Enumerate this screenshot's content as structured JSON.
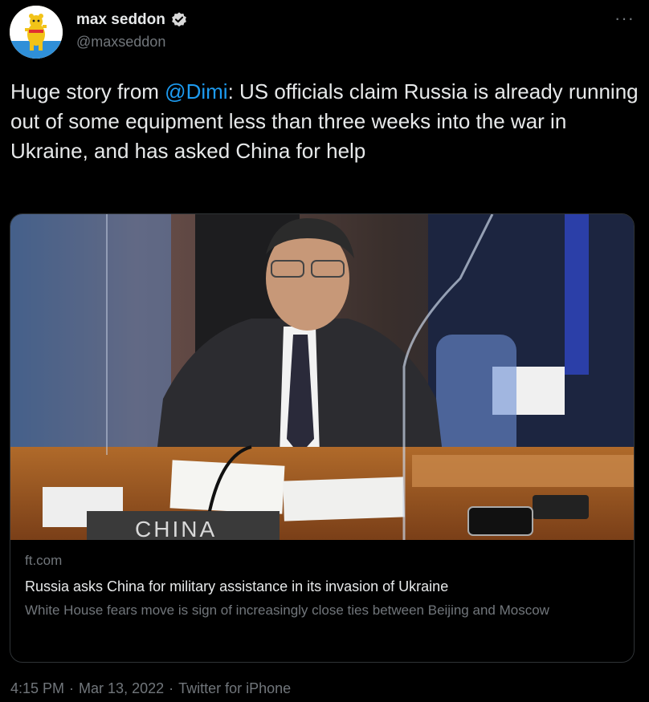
{
  "author": {
    "display_name": "max seddon",
    "handle": "@maxseddon",
    "verified": true,
    "avatar_icon": "bear-flag-avatar"
  },
  "more_label": "···",
  "tweet": {
    "prefix": "Huge story from ",
    "mention": "@Dimi",
    "body": ": US officials claim Russia is already running out of some equipment less than three weeks into the war in Ukraine, and has asked China for help"
  },
  "card": {
    "image_alt": "CHINA",
    "nameplate_text": "CHINA",
    "domain": "ft.com",
    "title": "Russia asks China for military assistance in its invasion of Ukraine",
    "description": "White House fears move is sign of increasingly close ties between Beijing and Moscow"
  },
  "meta": {
    "time": "4:15 PM",
    "separator1": "·",
    "date": "Mar 13, 2022",
    "separator2": "·",
    "source": "Twitter for iPhone"
  },
  "colors": {
    "background": "#000000",
    "text": "#e7e9ea",
    "secondary": "#71767b",
    "link": "#1d9bf0",
    "verified_badge": "#d9d9d9",
    "card_border": "#2f3336"
  }
}
